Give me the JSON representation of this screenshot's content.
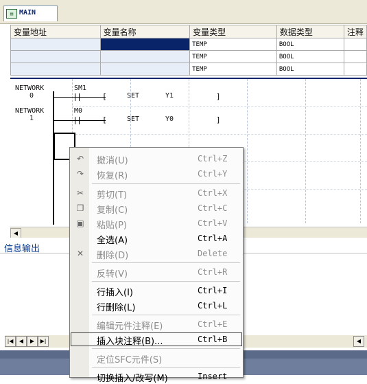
{
  "tab": {
    "label": "MAIN"
  },
  "var_table": {
    "headers": [
      "变量地址",
      "变量名称",
      "变量类型",
      "数据类型",
      "注释"
    ],
    "rows": [
      [
        "",
        "",
        "TEMP",
        "BOOL",
        ""
      ],
      [
        "",
        "",
        "TEMP",
        "BOOL",
        ""
      ],
      [
        "",
        "",
        "TEMP",
        "BOOL",
        ""
      ]
    ]
  },
  "ladder": {
    "networks": [
      {
        "label": "NETWORK",
        "num": "0",
        "contact": "SM1",
        "instr": "SET",
        "operand": "Y1"
      },
      {
        "label": "NETWORK",
        "num": "1",
        "contact": "M0",
        "instr": "SET",
        "operand": "Y0"
      }
    ]
  },
  "output_panel": {
    "title": "信息输出"
  },
  "context_menu": {
    "items": [
      {
        "label": "撤消(U)",
        "shortcut": "Ctrl+Z",
        "disabled": true,
        "icon": "undo-icon"
      },
      {
        "label": "恢复(R)",
        "shortcut": "Ctrl+Y",
        "disabled": true,
        "icon": "redo-icon"
      },
      {
        "label": "剪切(T)",
        "shortcut": "Ctrl+X",
        "disabled": true,
        "icon": "cut-icon"
      },
      {
        "label": "复制(C)",
        "shortcut": "Ctrl+C",
        "disabled": true,
        "icon": "copy-icon"
      },
      {
        "label": "粘贴(P)",
        "shortcut": "Ctrl+V",
        "disabled": true,
        "icon": "paste-icon"
      },
      {
        "label": "全选(A)",
        "shortcut": "Ctrl+A",
        "disabled": false,
        "icon": ""
      },
      {
        "label": "删除(D)",
        "shortcut": "Delete",
        "disabled": true,
        "icon": "delete-icon"
      },
      {
        "label": "反转(V)",
        "shortcut": "Ctrl+R",
        "disabled": true,
        "icon": ""
      },
      {
        "label": "行插入(I)",
        "shortcut": "Ctrl+I",
        "disabled": false,
        "icon": ""
      },
      {
        "label": "行删除(L)",
        "shortcut": "Ctrl+L",
        "disabled": false,
        "icon": ""
      },
      {
        "label": "编辑元件注释(E)",
        "shortcut": "Ctrl+E",
        "disabled": true,
        "icon": ""
      },
      {
        "label": "插入块注释(B)...",
        "shortcut": "Ctrl+B",
        "disabled": false,
        "icon": "",
        "highlighted": true
      },
      {
        "label": "定位SFC元件(S)",
        "shortcut": "",
        "disabled": true,
        "icon": ""
      },
      {
        "label": "切换插入/改写(M)",
        "shortcut": "Insert",
        "disabled": false,
        "icon": ""
      }
    ]
  }
}
